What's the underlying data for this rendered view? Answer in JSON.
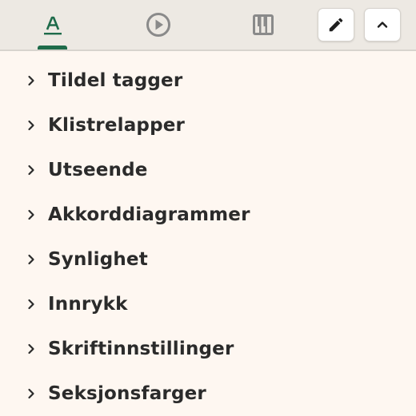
{
  "colors": {
    "background": "#fef7f1",
    "toolbar_background": "#ede9e3",
    "accent": "#1e6b4a",
    "icon_inactive": "#8a8a8a",
    "text": "#2b2b2b"
  },
  "tabs": [
    {
      "icon": "text-format-icon",
      "active": true
    },
    {
      "icon": "play-circle-icon",
      "active": false
    },
    {
      "icon": "piano-keys-icon",
      "active": false
    }
  ],
  "toolbar": {
    "edit_icon": "pencil-icon",
    "collapse_icon": "chevron-up-icon"
  },
  "sections": [
    {
      "label": "Tildel tagger"
    },
    {
      "label": "Klistrelapper"
    },
    {
      "label": "Utseende"
    },
    {
      "label": "Akkorddiagrammer"
    },
    {
      "label": "Synlighet"
    },
    {
      "label": "Innrykk"
    },
    {
      "label": "Skriftinnstillinger"
    },
    {
      "label": "Seksjonsfarger"
    }
  ]
}
